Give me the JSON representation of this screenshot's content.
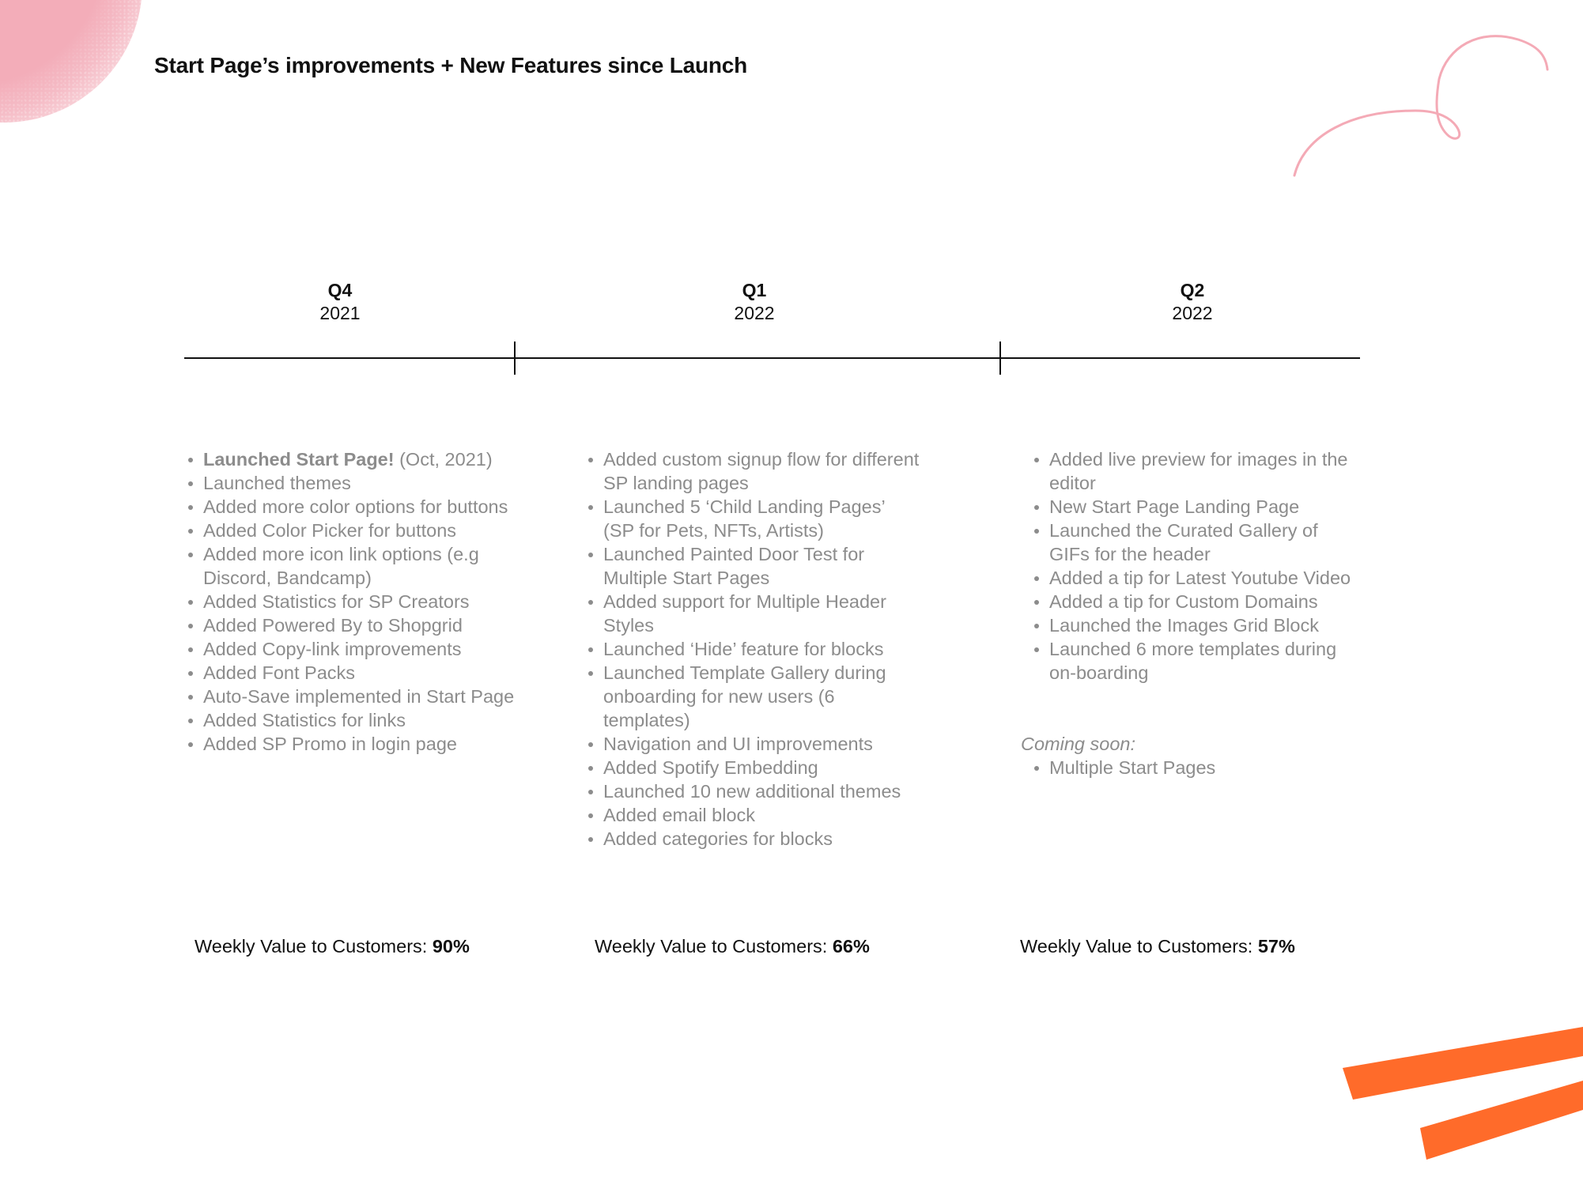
{
  "title": "Start Page’s improvements + New Features since Launch",
  "colors": {
    "accent_orange": "#ff6b2a",
    "accent_pink": "#f3adb9",
    "text_primary": "#111111",
    "text_muted": "#8c8c8c"
  },
  "decorations": [
    "pink-blob",
    "pink-squiggle",
    "orange-stripes"
  ],
  "quarters": [
    {
      "quarter": "Q4",
      "year": "2021",
      "items": [
        {
          "bold": "Launched Start Page!",
          "text": " (Oct, 2021)"
        },
        {
          "bold": "",
          "text": "Launched  themes"
        },
        {
          "bold": "",
          "text": "Added more color options for buttons"
        },
        {
          "bold": "",
          "text": "Added Color Picker for buttons"
        },
        {
          "bold": "",
          "text": "Added more icon link options (e.g Discord, Bandcamp)"
        },
        {
          "bold": "",
          "text": "Added Statistics for SP Creators"
        },
        {
          "bold": "",
          "text": "Added Powered By to Shopgrid"
        },
        {
          "bold": "",
          "text": "Added Copy-link improvements"
        },
        {
          "bold": "",
          "text": "Added Font Packs"
        },
        {
          "bold": "",
          "text": "Auto-Save implemented in Start Page"
        },
        {
          "bold": "",
          "text": "Added Statistics for links"
        },
        {
          "bold": "",
          "text": "Added SP Promo in login page"
        }
      ],
      "weekly_label": "Weekly Value to Customers: ",
      "weekly_value": "90%"
    },
    {
      "quarter": "Q1",
      "year": "2022",
      "items": [
        {
          "bold": "",
          "text": "Added custom signup flow for different SP landing pages"
        },
        {
          "bold": "",
          "text": "Launched 5  ‘Child Landing Pages’ (SP for Pets, NFTs, Artists)"
        },
        {
          "bold": "",
          "text": "Launched Painted Door Test for Multiple  Start Pages"
        },
        {
          "bold": "",
          "text": "Added support for Multiple Header Styles"
        },
        {
          "bold": "",
          "text": "Launched ‘Hide’ feature for blocks"
        },
        {
          "bold": "",
          "text": "Launched Template Gallery during onboarding for new users (6 templates)"
        },
        {
          "bold": "",
          "text": "Navigation and UI improvements"
        },
        {
          "bold": "",
          "text": "Added Spotify Embedding"
        },
        {
          "bold": "",
          "text": "Launched 10 new additional themes"
        },
        {
          "bold": "",
          "text": "Added email block"
        },
        {
          "bold": "",
          "text": "Added categories for blocks"
        }
      ],
      "weekly_label": "Weekly Value to Customers: ",
      "weekly_value": "66%"
    },
    {
      "quarter": "Q2",
      "year": "2022",
      "items": [
        {
          "bold": "",
          "text": "Added live preview for images in the editor"
        },
        {
          "bold": "",
          "text": "New Start Page Landing Page"
        },
        {
          "bold": "",
          "text": "Launched the Curated Gallery of GIFs for the header"
        },
        {
          "bold": "",
          "text": "Added a tip for Latest Youtube Video"
        },
        {
          "bold": "",
          "text": "Added a tip for Custom Domains"
        },
        {
          "bold": "",
          "text": "Launched the Images Grid Block"
        },
        {
          "bold": "",
          "text": "Launched 6 more templates during on-boarding"
        }
      ],
      "coming_soon_label": "Coming soon:",
      "coming_soon_items": [
        "Multiple Start Pages"
      ],
      "weekly_label": "Weekly Value to Customers: ",
      "weekly_value": "57%"
    }
  ]
}
